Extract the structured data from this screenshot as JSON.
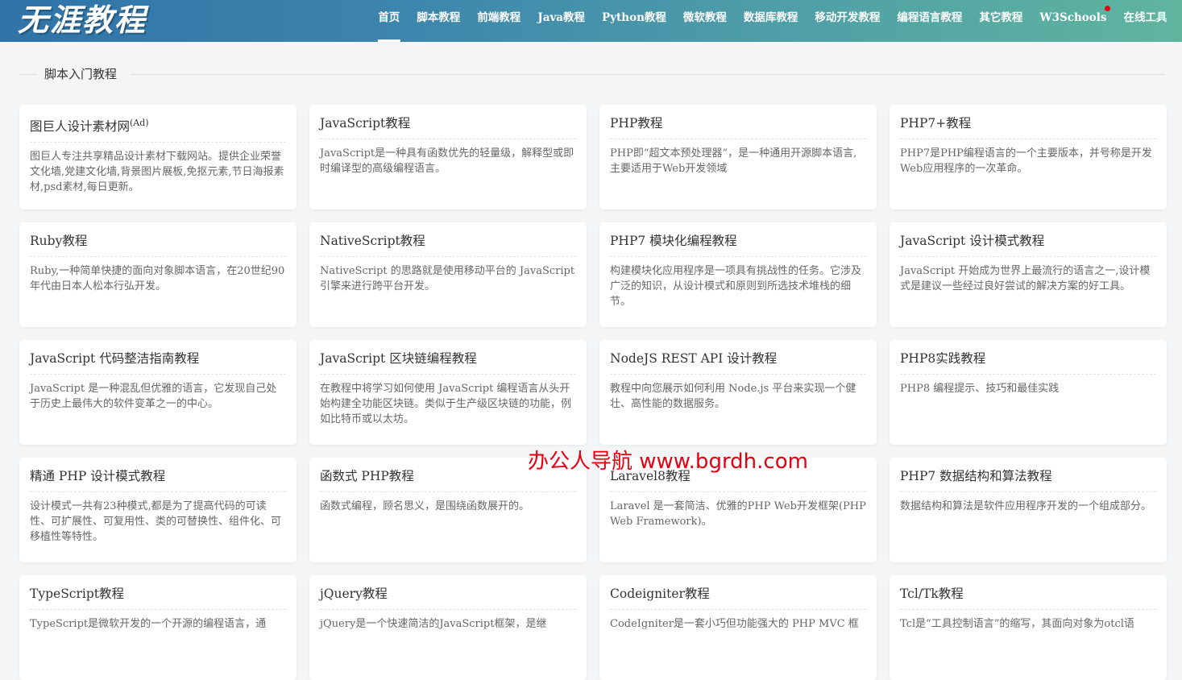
{
  "header": {
    "logo_text": "无涯教程",
    "nav": [
      {
        "label": "首页",
        "active": true
      },
      {
        "label": "脚本教程"
      },
      {
        "label": "前端教程"
      },
      {
        "label": "Java教程"
      },
      {
        "label": "Python教程"
      },
      {
        "label": "微软教程"
      },
      {
        "label": "数据库教程"
      },
      {
        "label": "移动开发教程"
      },
      {
        "label": "编程语言教程"
      },
      {
        "label": "其它教程"
      },
      {
        "label": "W3Schools",
        "badge_dot": true
      },
      {
        "label": "在线工具"
      }
    ],
    "colors": {
      "gradient_start": "#2f73a8",
      "gradient_end": "#5fb59e",
      "badge": "#e60012"
    }
  },
  "section": {
    "title": "脚本入门教程"
  },
  "cards": [
    {
      "title": "图巨人设计素材网",
      "ad_label": "(Ad)",
      "desc": "图巨人专注共享精品设计素材下载网站。提供企业荣誉文化墙,党建文化墙,背景图片展板,免抠元素,节日海报素材,psd素材,每日更新。"
    },
    {
      "title": "JavaScript教程",
      "desc": "JavaScript是一种具有函数优先的轻量级，解释型或即时编译型的高级编程语言。"
    },
    {
      "title": "PHP教程",
      "desc": "PHP即“超文本预处理器”，是一种通用开源脚本语言,主要适用于Web开发领域"
    },
    {
      "title": "PHP7+教程",
      "desc": "PHP7是PHP编程语言的一个主要版本，并号称是开发Web应用程序的一次革命。"
    },
    {
      "title": "Ruby教程",
      "desc": "Ruby,一种简单快捷的面向对象脚本语言，在20世纪90年代由日本人松本行弘开发。"
    },
    {
      "title": "NativeScript教程",
      "desc": "NativeScript 的思路就是使用移动平台的 JavaScript 引擎来进行跨平台开发。"
    },
    {
      "title": "PHP7 模块化编程教程",
      "desc": "构建模块化应用程序是一项具有挑战性的任务。它涉及广泛的知识，从设计模式和原则到所选技术堆栈的细节。"
    },
    {
      "title": "JavaScript 设计模式教程",
      "desc": "JavaScript 开始成为世界上最流行的语言之一,设计模式是建议一些经过良好尝试的解决方案的好工具。"
    },
    {
      "title": "JavaScript 代码整洁指南教程",
      "desc": "JavaScript 是一种混乱但优雅的语言，它发现自己处于历史上最伟大的软件变革之一的中心。"
    },
    {
      "title": "JavaScript 区块链编程教程",
      "desc": "在教程中将学习如何使用 JavaScript 编程语言从头开始构建全功能区块链。类似于生产级区块链的功能，例如比特币或以太坊。"
    },
    {
      "title": "NodeJS REST API 设计教程",
      "desc": "教程中向您展示如何利用 Node.js 平台来实现一个健壮、高性能的数据服务。"
    },
    {
      "title": "PHP8实践教程",
      "desc": "PHP8 编程提示、技巧和最佳实践"
    },
    {
      "title": "精通 PHP 设计模式教程",
      "desc": "设计模式一共有23种模式,都是为了提高代码的可读性、可扩展性、可复用性、类的可替换性、组件化、可移植性等特性。"
    },
    {
      "title": "函数式 PHP教程",
      "desc": "函数式编程，顾名思义，是围绕函数展开的。"
    },
    {
      "title": "Laravel8教程",
      "desc": "Laravel 是一套简洁、优雅的PHP Web开发框架(PHP Web Framework)。"
    },
    {
      "title": "PHP7 数据结构和算法教程",
      "desc": "数据结构和算法是软件应用程序开发的一个组成部分。"
    },
    {
      "title": "TypeScript教程",
      "desc": "TypeScript是微软开发的一个开源的编程语言，通"
    },
    {
      "title": "jQuery教程",
      "desc": "jQuery是一个快速简洁的JavaScript框架，是继"
    },
    {
      "title": "Codeigniter教程",
      "desc": "CodeIgniter是一套小巧但功能强大的 PHP MVC 框"
    },
    {
      "title": "Tcl/Tk教程",
      "desc": "Tcl是“工具控制语言”的缩写，其面向对象为otcl语"
    }
  ],
  "watermark": "办公人导航  www.bgrdh.com"
}
